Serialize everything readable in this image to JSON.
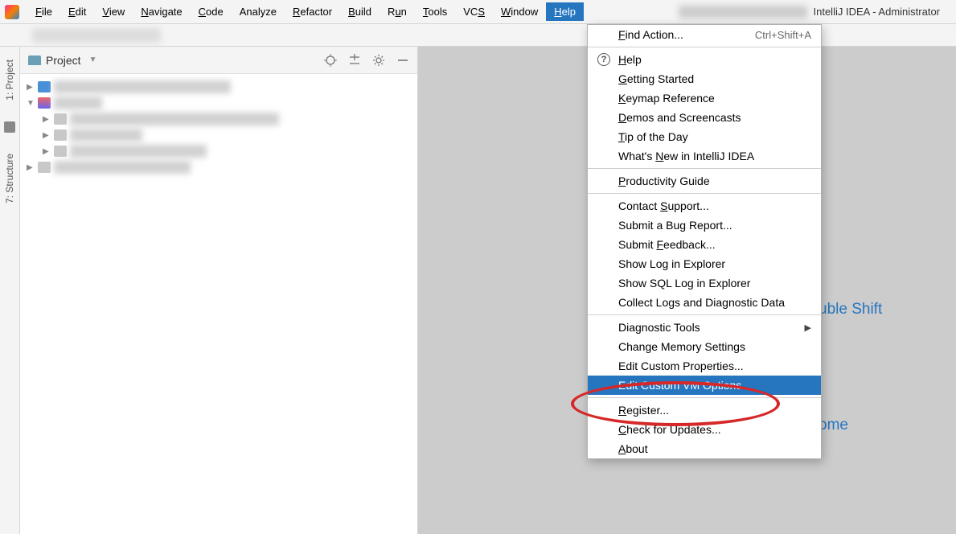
{
  "titlebar": {
    "app_suffix": "IntelliJ IDEA - Administrator"
  },
  "menubar": {
    "items": [
      {
        "label": "File",
        "u": "F"
      },
      {
        "label": "Edit",
        "u": "E"
      },
      {
        "label": "View",
        "u": "V"
      },
      {
        "label": "Navigate",
        "u": "N"
      },
      {
        "label": "Code",
        "u": "C"
      },
      {
        "label": "Analyze",
        "u": null
      },
      {
        "label": "Refactor",
        "u": "R"
      },
      {
        "label": "Build",
        "u": "B"
      },
      {
        "label": "Run",
        "u": "u"
      },
      {
        "label": "Tools",
        "u": "T"
      },
      {
        "label": "VCS",
        "u": "S"
      },
      {
        "label": "Window",
        "u": "W"
      },
      {
        "label": "Help",
        "u": "H",
        "active": true
      }
    ]
  },
  "left_sidebar": {
    "tabs": [
      {
        "label": "1: Project"
      },
      {
        "label": "7: Structure"
      }
    ]
  },
  "project_panel": {
    "title": "Project"
  },
  "help_menu": {
    "items": [
      {
        "label": "Find Action...",
        "shortcut": "Ctrl+Shift+A",
        "u": "F"
      },
      {
        "sep": true
      },
      {
        "label": "Help",
        "icon": "?",
        "u": "H"
      },
      {
        "label": "Getting Started",
        "u": "G"
      },
      {
        "label": "Keymap Reference",
        "u": "K"
      },
      {
        "label": "Demos and Screencasts",
        "u": "D"
      },
      {
        "label": "Tip of the Day",
        "u": "T"
      },
      {
        "label": "What's New in IntelliJ IDEA",
        "u": "N"
      },
      {
        "sep": true
      },
      {
        "label": "Productivity Guide",
        "u": "P"
      },
      {
        "sep": true
      },
      {
        "label": "Contact Support...",
        "u": "S"
      },
      {
        "label": "Submit a Bug Report..."
      },
      {
        "label": "Submit Feedback...",
        "u": "F"
      },
      {
        "label": "Show Log in Explorer"
      },
      {
        "label": "Show SQL Log in Explorer"
      },
      {
        "label": "Collect Logs and Diagnostic Data"
      },
      {
        "sep": true
      },
      {
        "label": "Diagnostic Tools",
        "submenu": true
      },
      {
        "label": "Change Memory Settings"
      },
      {
        "label": "Edit Custom Properties..."
      },
      {
        "label": "Edit Custom VM Options...",
        "highlighted": true
      },
      {
        "sep": true
      },
      {
        "label": "Register...",
        "u": "R"
      },
      {
        "label": "Check for Updates...",
        "u": "C"
      },
      {
        "label": "About",
        "u": "A"
      }
    ]
  },
  "bg_links": {
    "a": "uble Shift",
    "b": "ome"
  }
}
